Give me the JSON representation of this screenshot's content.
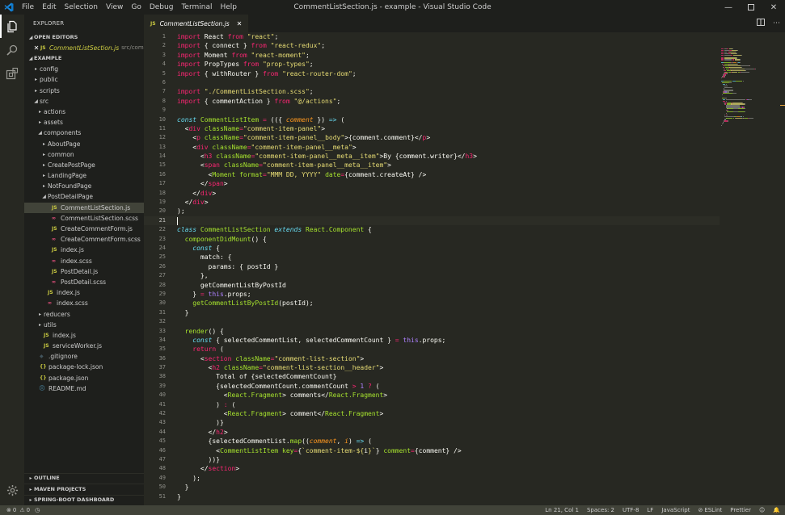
{
  "window": {
    "title": "CommentListSection.js - example - Visual Studio Code",
    "menu": [
      "File",
      "Edit",
      "Selection",
      "View",
      "Go",
      "Debug",
      "Terminal",
      "Help"
    ]
  },
  "activity_bar": {
    "items": [
      "files-icon",
      "search-icon",
      "extensions-icon"
    ],
    "settings": "gear-icon"
  },
  "sidebar": {
    "title": "EXPLORER",
    "open_editors_label": "OPEN EDITORS",
    "open_editors": [
      {
        "name": "CommentListSection.js",
        "desc": "src/com..."
      }
    ],
    "project_label": "EXAMPLE",
    "tree": [
      {
        "depth": 0,
        "kind": "folder",
        "open": false,
        "name": "config"
      },
      {
        "depth": 0,
        "kind": "folder",
        "open": false,
        "name": "public"
      },
      {
        "depth": 0,
        "kind": "folder",
        "open": false,
        "name": "scripts"
      },
      {
        "depth": 0,
        "kind": "folder",
        "open": true,
        "name": "src"
      },
      {
        "depth": 1,
        "kind": "folder",
        "open": false,
        "name": "actions"
      },
      {
        "depth": 1,
        "kind": "folder",
        "open": false,
        "name": "assets"
      },
      {
        "depth": 1,
        "kind": "folder",
        "open": true,
        "name": "components"
      },
      {
        "depth": 2,
        "kind": "folder",
        "open": false,
        "name": "AboutPage"
      },
      {
        "depth": 2,
        "kind": "folder",
        "open": false,
        "name": "common"
      },
      {
        "depth": 2,
        "kind": "folder",
        "open": false,
        "name": "CreatePostPage"
      },
      {
        "depth": 2,
        "kind": "folder",
        "open": false,
        "name": "LandingPage"
      },
      {
        "depth": 2,
        "kind": "folder",
        "open": false,
        "name": "NotFoundPage"
      },
      {
        "depth": 2,
        "kind": "folder",
        "open": true,
        "name": "PostDetailPage"
      },
      {
        "depth": 3,
        "kind": "js",
        "name": "CommentListSection.js",
        "selected": true
      },
      {
        "depth": 3,
        "kind": "scss",
        "name": "CommentListSection.scss"
      },
      {
        "depth": 3,
        "kind": "js",
        "name": "CreateCommentForm.js"
      },
      {
        "depth": 3,
        "kind": "scss",
        "name": "CreateCommentForm.scss"
      },
      {
        "depth": 3,
        "kind": "js",
        "name": "index.js"
      },
      {
        "depth": 3,
        "kind": "scss",
        "name": "index.scss"
      },
      {
        "depth": 3,
        "kind": "js",
        "name": "PostDetail.js"
      },
      {
        "depth": 3,
        "kind": "scss",
        "name": "PostDetail.scss"
      },
      {
        "depth": 2,
        "kind": "js",
        "name": "index.js"
      },
      {
        "depth": 2,
        "kind": "scss",
        "name": "index.scss"
      },
      {
        "depth": 1,
        "kind": "folder",
        "open": false,
        "name": "reducers"
      },
      {
        "depth": 1,
        "kind": "folder",
        "open": false,
        "name": "utils"
      },
      {
        "depth": 1,
        "kind": "js",
        "name": "index.js"
      },
      {
        "depth": 1,
        "kind": "js",
        "name": "serviceWorker.js"
      },
      {
        "depth": 0,
        "kind": "git",
        "name": ".gitignore"
      },
      {
        "depth": 0,
        "kind": "json",
        "name": "package-lock.json"
      },
      {
        "depth": 0,
        "kind": "json",
        "name": "package.json"
      },
      {
        "depth": 0,
        "kind": "info",
        "name": "README.md"
      }
    ],
    "bottom_sections": [
      "OUTLINE",
      "MAVEN PROJECTS",
      "SPRING-BOOT DASHBOARD"
    ]
  },
  "editor": {
    "tab": {
      "label": "CommentListSection.js",
      "icon": "JS"
    },
    "current_line": 21,
    "lines": [
      [
        [
          "k",
          "import "
        ],
        [
          "x",
          "React "
        ],
        [
          "k",
          "from "
        ],
        [
          "s",
          "\"react\""
        ],
        [
          "x",
          ";"
        ]
      ],
      [
        [
          "k",
          "import "
        ],
        [
          "x",
          "{ connect } "
        ],
        [
          "k",
          "from "
        ],
        [
          "s",
          "\"react-redux\""
        ],
        [
          "x",
          ";"
        ]
      ],
      [
        [
          "k",
          "import "
        ],
        [
          "x",
          "Moment "
        ],
        [
          "k",
          "from "
        ],
        [
          "s",
          "\"react-moment\""
        ],
        [
          "x",
          ";"
        ]
      ],
      [
        [
          "k",
          "import "
        ],
        [
          "x",
          "PropTypes "
        ],
        [
          "k",
          "from "
        ],
        [
          "s",
          "\"prop-types\""
        ],
        [
          "x",
          ";"
        ]
      ],
      [
        [
          "k",
          "import "
        ],
        [
          "x",
          "{ withRouter } "
        ],
        [
          "k",
          "from "
        ],
        [
          "s",
          "\"react-router-dom\""
        ],
        [
          "x",
          ";"
        ]
      ],
      [],
      [
        [
          "k",
          "import "
        ],
        [
          "s",
          "\"./CommentListSection.scss\""
        ],
        [
          "x",
          ";"
        ]
      ],
      [
        [
          "k",
          "import "
        ],
        [
          "x",
          "{ commentAction } "
        ],
        [
          "k",
          "from "
        ],
        [
          "s",
          "\"@/actions\""
        ],
        [
          "x",
          ";"
        ]
      ],
      [],
      [
        [
          "c",
          "const "
        ],
        [
          "f",
          "CommentListItem "
        ],
        [
          "k",
          "= "
        ],
        [
          "x",
          "(({ "
        ],
        [
          "p",
          "comment"
        ],
        [
          "x",
          " }) "
        ],
        [
          "c",
          "=> "
        ],
        [
          "x",
          "("
        ]
      ],
      [
        [
          "x",
          "  <"
        ],
        [
          "tag",
          "div "
        ],
        [
          "attr",
          "className"
        ],
        [
          "k",
          "="
        ],
        [
          "s",
          "\"comment-item-panel\""
        ],
        [
          "x",
          ">"
        ]
      ],
      [
        [
          "x",
          "    <"
        ],
        [
          "tag",
          "p "
        ],
        [
          "attr",
          "className"
        ],
        [
          "k",
          "="
        ],
        [
          "s",
          "\"comment-item-panel__body\""
        ],
        [
          "x",
          ">{comment.comment}</"
        ],
        [
          "tag",
          "p"
        ],
        [
          "x",
          ">"
        ]
      ],
      [
        [
          "x",
          "    <"
        ],
        [
          "tag",
          "div "
        ],
        [
          "attr",
          "className"
        ],
        [
          "k",
          "="
        ],
        [
          "s",
          "\"comment-item-panel__meta\""
        ],
        [
          "x",
          ">"
        ]
      ],
      [
        [
          "x",
          "      <"
        ],
        [
          "tag",
          "h3 "
        ],
        [
          "attr",
          "className"
        ],
        [
          "k",
          "="
        ],
        [
          "s",
          "\"comment-item-panel__meta__item\""
        ],
        [
          "x",
          ">By {comment.writer}</"
        ],
        [
          "tag",
          "h3"
        ],
        [
          "x",
          ">"
        ]
      ],
      [
        [
          "x",
          "      <"
        ],
        [
          "tag",
          "span "
        ],
        [
          "attr",
          "className"
        ],
        [
          "k",
          "="
        ],
        [
          "s",
          "\"comment-item-panel__meta__item\""
        ],
        [
          "x",
          ">"
        ]
      ],
      [
        [
          "x",
          "        <"
        ],
        [
          "t",
          "Moment "
        ],
        [
          "attr",
          "format"
        ],
        [
          "k",
          "="
        ],
        [
          "s",
          "\"MMM DD, YYYY\" "
        ],
        [
          "attr",
          "date"
        ],
        [
          "k",
          "="
        ],
        [
          "x",
          "{comment.createAt} />"
        ]
      ],
      [
        [
          "x",
          "      </"
        ],
        [
          "tag",
          "span"
        ],
        [
          "x",
          ">"
        ]
      ],
      [
        [
          "x",
          "    </"
        ],
        [
          "tag",
          "div"
        ],
        [
          "x",
          ">"
        ]
      ],
      [
        [
          "x",
          "  </"
        ],
        [
          "tag",
          "div"
        ],
        [
          "x",
          ">"
        ]
      ],
      [
        [
          "x",
          ");"
        ]
      ],
      [],
      [
        [
          "c",
          "class "
        ],
        [
          "t",
          "CommentListSection "
        ],
        [
          "c",
          "extends "
        ],
        [
          "t",
          "React.Component "
        ],
        [
          "x",
          "{"
        ]
      ],
      [
        [
          "x",
          "  "
        ],
        [
          "f",
          "componentDidMount"
        ],
        [
          "x",
          "() {"
        ]
      ],
      [
        [
          "x",
          "    "
        ],
        [
          "c",
          "const "
        ],
        [
          "x",
          "{"
        ]
      ],
      [
        [
          "x",
          "      match: {"
        ]
      ],
      [
        [
          "x",
          "        params: { postId }"
        ]
      ],
      [
        [
          "x",
          "      },"
        ]
      ],
      [
        [
          "x",
          "      getCommentListByPostId"
        ]
      ],
      [
        [
          "x",
          "    } "
        ],
        [
          "k",
          "= "
        ],
        [
          "v",
          "this"
        ],
        [
          "x",
          ".props;"
        ]
      ],
      [
        [
          "x",
          "    "
        ],
        [
          "f",
          "getCommentListByPostId"
        ],
        [
          "x",
          "(postId);"
        ]
      ],
      [
        [
          "x",
          "  }"
        ]
      ],
      [],
      [
        [
          "x",
          "  "
        ],
        [
          "f",
          "render"
        ],
        [
          "x",
          "() {"
        ]
      ],
      [
        [
          "x",
          "    "
        ],
        [
          "c",
          "const "
        ],
        [
          "x",
          "{ selectedCommentList, selectedCommentCount } "
        ],
        [
          "k",
          "= "
        ],
        [
          "v",
          "this"
        ],
        [
          "x",
          ".props;"
        ]
      ],
      [
        [
          "x",
          "    "
        ],
        [
          "k",
          "return "
        ],
        [
          "x",
          "("
        ]
      ],
      [
        [
          "x",
          "      <"
        ],
        [
          "tag",
          "section "
        ],
        [
          "attr",
          "className"
        ],
        [
          "k",
          "="
        ],
        [
          "s",
          "\"comment-list-section\""
        ],
        [
          "x",
          ">"
        ]
      ],
      [
        [
          "x",
          "        <"
        ],
        [
          "tag",
          "h2 "
        ],
        [
          "attr",
          "className"
        ],
        [
          "k",
          "="
        ],
        [
          "s",
          "\"comment-list-section__header\""
        ],
        [
          "x",
          ">"
        ]
      ],
      [
        [
          "x",
          "          Total of {selectedCommentCount}"
        ]
      ],
      [
        [
          "x",
          "          {selectedCommentCount.commentCount "
        ],
        [
          "k",
          "> "
        ],
        [
          "v",
          "1 "
        ],
        [
          "k",
          "? "
        ],
        [
          "x",
          "("
        ]
      ],
      [
        [
          "x",
          "            <"
        ],
        [
          "t",
          "React.Fragment"
        ],
        [
          "x",
          "> comments</"
        ],
        [
          "t",
          "React.Fragment"
        ],
        [
          "x",
          ">"
        ]
      ],
      [
        [
          "x",
          "          ) "
        ],
        [
          "k",
          ": "
        ],
        [
          "x",
          "("
        ]
      ],
      [
        [
          "x",
          "            <"
        ],
        [
          "t",
          "React.Fragment"
        ],
        [
          "x",
          "> comment</"
        ],
        [
          "t",
          "React.Fragment"
        ],
        [
          "x",
          ">"
        ]
      ],
      [
        [
          "x",
          "          )}"
        ]
      ],
      [
        [
          "x",
          "        </"
        ],
        [
          "tag",
          "h2"
        ],
        [
          "x",
          ">"
        ]
      ],
      [
        [
          "x",
          "        {selectedCommentList."
        ],
        [
          "f",
          "map"
        ],
        [
          "x",
          "(("
        ],
        [
          "p",
          "comment"
        ],
        [
          "x",
          ", "
        ],
        [
          "p",
          "i"
        ],
        [
          "x",
          ") "
        ],
        [
          "c",
          "=> "
        ],
        [
          "x",
          "("
        ]
      ],
      [
        [
          "x",
          "          <"
        ],
        [
          "t",
          "CommentListItem "
        ],
        [
          "attr",
          "key"
        ],
        [
          "k",
          "="
        ],
        [
          "x",
          "{"
        ],
        [
          "s",
          "`comment-item-${"
        ],
        [
          "x",
          "i"
        ],
        [
          "s",
          "}`"
        ],
        [
          "x",
          "} "
        ],
        [
          "attr",
          "comment"
        ],
        [
          "k",
          "="
        ],
        [
          "x",
          "{comment} />"
        ]
      ],
      [
        [
          "x",
          "        ))}"
        ]
      ],
      [
        [
          "x",
          "      </"
        ],
        [
          "tag",
          "section"
        ],
        [
          "x",
          ">"
        ]
      ],
      [
        [
          "x",
          "    );"
        ]
      ],
      [
        [
          "x",
          "  }"
        ]
      ],
      [
        [
          "x",
          "}"
        ]
      ]
    ]
  },
  "status_bar": {
    "errors": "0",
    "warnings": "0",
    "position": "Ln 21, Col 1",
    "spaces": "Spaces: 2",
    "encoding": "UTF-8",
    "eol": "LF",
    "language": "JavaScript",
    "eslint": "ESLint",
    "prettier": "Prettier"
  },
  "colors": {
    "editor_bg": "#272822",
    "sidebar_bg": "#1e1f1c",
    "status_bg": "#414339",
    "selection": "#414339",
    "js_icon": "#cbcb41",
    "scss_icon": "#f55385",
    "json_icon": "#cbcb41",
    "info_icon": "#519aba",
    "folder_arrow": "#c5c5c5"
  }
}
